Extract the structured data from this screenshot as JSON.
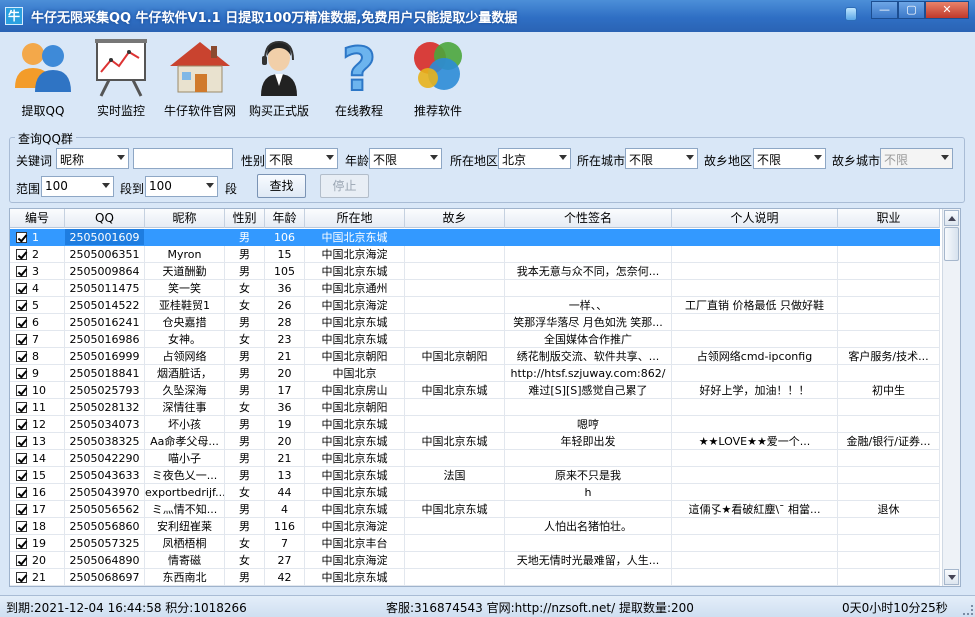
{
  "window": {
    "title": "牛仔无限采集QQ  牛仔软件V1.1 日提取100万精准数据,免费用户只能提取少量数据",
    "app_icon": "牛",
    "buttons": [
      "minimize",
      "maximize",
      "close"
    ]
  },
  "toolbar": [
    {
      "id": "extract",
      "label": "提取QQ",
      "icon": "users-icon"
    },
    {
      "id": "monitor",
      "label": "实时监控",
      "icon": "chart-board-icon"
    },
    {
      "id": "website",
      "label": "牛仔软件官网",
      "icon": "house-icon"
    },
    {
      "id": "buy",
      "label": "购买正式版",
      "icon": "support-agent-icon"
    },
    {
      "id": "tutorial",
      "label": "在线教程",
      "icon": "question-icon"
    },
    {
      "id": "recommend",
      "label": "推荐软件",
      "icon": "color-circles-icon"
    }
  ],
  "query": {
    "group_title": "查询QQ群",
    "keyword_label": "关键词",
    "keyword_type": "昵称",
    "keyword_value": "",
    "gender_label": "性别",
    "gender": "不限",
    "age_label": "年龄",
    "age": "不限",
    "region_label": "所在地区",
    "region": "北京",
    "city_label": "所在城市",
    "city": "不限",
    "hometown_label": "故乡地区",
    "hometown": "不限",
    "hometown_city_label": "故乡城市",
    "hometown_city": "不限",
    "range_label": "范围",
    "range": "100",
    "seg_label": "段到",
    "seg": "100",
    "seg_unit": "段",
    "search_btn": "查找",
    "stop_btn": "停止"
  },
  "table": {
    "columns": [
      "编号",
      "QQ",
      "昵称",
      "性别",
      "年龄",
      "所在地",
      "故乡",
      "个性签名",
      "个人说明",
      "职业"
    ],
    "rows": [
      [
        "1",
        "2505001609",
        "",
        "男",
        "106",
        "中国北京东城",
        "",
        "",
        "",
        ""
      ],
      [
        "2",
        "2505006351",
        "Myron",
        "男",
        "15",
        "中国北京海淀",
        "",
        "",
        "",
        ""
      ],
      [
        "3",
        "2505009864",
        "天道酬勤",
        "男",
        "105",
        "中国北京东城",
        "",
        "我本无意与众不同，怎奈何...",
        "",
        ""
      ],
      [
        "4",
        "2505011475",
        "笑一笑",
        "女",
        "36",
        "中国北京通州",
        "",
        "",
        "",
        ""
      ],
      [
        "5",
        "2505014522",
        "亚桂鞋贸1",
        "女",
        "26",
        "中国北京海淀",
        "",
        "一样、、",
        "工厂直销 价格最低 只做好鞋",
        ""
      ],
      [
        "6",
        "2505016241",
        "仓央嘉措",
        "男",
        "28",
        "中国北京东城",
        "",
        "笑那浮华落尽 月色如洗 笑那...",
        "",
        ""
      ],
      [
        "7",
        "2505016986",
        "女神。",
        "女",
        "23",
        "中国北京东城",
        "",
        "全国媒体合作推广",
        "",
        ""
      ],
      [
        "8",
        "2505016999",
        "占领网络",
        "男",
        "21",
        "中国北京朝阳",
        "中国北京朝阳",
        "绣花制版交流、软件共享、...",
        "占领网络cmd-ipconfig",
        "客户服务/技术..."
      ],
      [
        "9",
        "2505018841",
        "烟酒脏话，",
        "男",
        "20",
        "中国北京",
        "",
        "http://htsf.szjuway.com:862/",
        "",
        ""
      ],
      [
        "10",
        "2505025793",
        "久坠深海",
        "男",
        "17",
        "中国北京房山",
        "中国北京东城",
        "难过[S][S]感觉自己累了",
        "好好上学，加油！！！",
        "初中生"
      ],
      [
        "11",
        "2505028132",
        "深情往事",
        "女",
        "36",
        "中国北京朝阳",
        "",
        "",
        "",
        ""
      ],
      [
        "12",
        "2505034073",
        "坏小孩",
        "男",
        "19",
        "中国北京东城",
        "",
        "嗯哼",
        "",
        ""
      ],
      [
        "13",
        "2505038325",
        "Aa命孝父母...",
        "男",
        "20",
        "中国北京东城",
        "中国北京东城",
        "年轻即出发",
        "★★LOVE★★爱一个...",
        "金融/银行/证券..."
      ],
      [
        "14",
        "2505042290",
        "喵小子",
        "男",
        "21",
        "中国北京东城",
        "",
        "",
        "",
        ""
      ],
      [
        "15",
        "2505043633",
        "ミ夜色乂一...",
        "男",
        "13",
        "中国北京东城",
        "法国",
        "原来不只是我",
        "",
        ""
      ],
      [
        "16",
        "2505043970",
        "exportbedrijf...",
        "女",
        "44",
        "中国北京东城",
        "",
        "h",
        "",
        ""
      ],
      [
        "17",
        "2505056562",
        "ミ灬情不知...",
        "男",
        "4",
        "中国北京东城",
        "中国北京东城",
        "",
        "這倆孓★看破紅塵\\ˉ 相當...",
        "退休"
      ],
      [
        "18",
        "2505056860",
        "安利纽崔莱",
        "男",
        "116",
        "中国北京海淀",
        "",
        "人怕出名猪怕壮。",
        "",
        ""
      ],
      [
        "19",
        "2505057325",
        "凤栖梧桐",
        "女",
        "7",
        "中国北京丰台",
        "",
        "",
        "",
        ""
      ],
      [
        "20",
        "2505064890",
        "情寄磁",
        "女",
        "27",
        "中国北京海淀",
        "",
        "天地无情时光最难留，人生...",
        "",
        ""
      ],
      [
        "21",
        "2505068697",
        "东西南北",
        "男",
        "42",
        "中国北京东城",
        "",
        "",
        "",
        ""
      ]
    ]
  },
  "status": {
    "expire": "到期:2021-12-04 16:44:58 积分:1018266",
    "service": "客服:316874543 官网:http://nzsoft.net/ 提取数量:200",
    "elapsed": "0天0小时10分25秒"
  }
}
